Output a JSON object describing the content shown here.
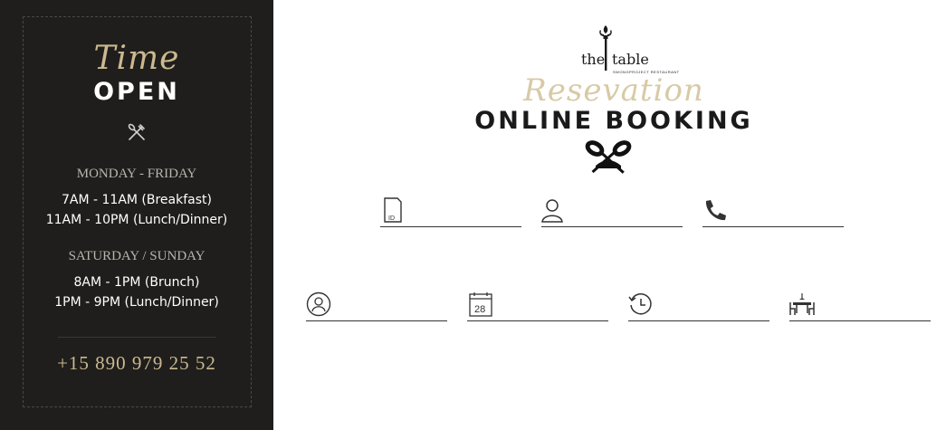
{
  "hours": {
    "script_title": "Time",
    "title": "OPEN",
    "weekday_heading": "MONDAY - FRIDAY",
    "weekday_lines": [
      "7AM - 11AM (Breakfast)",
      "11AM - 10PM (Lunch/Dinner)"
    ],
    "weekend_heading": "SATURDAY / SUNDAY",
    "weekend_lines": [
      "8AM - 1PM (Brunch)",
      "1PM - 9PM (Lunch/Dinner)"
    ],
    "phone": "+15 890 979 25 52"
  },
  "logo": {
    "word_the": "the",
    "word_table": "table",
    "tagline": "SWONGPROJECT RESTAURANT"
  },
  "booking": {
    "script_title": "Resevation",
    "title": "ONLINE BOOKING"
  },
  "form": {
    "date_day": "28",
    "fields": [
      {
        "icon": "id-card-icon",
        "value": ""
      },
      {
        "icon": "person-icon",
        "value": ""
      },
      {
        "icon": "phone-icon",
        "value": ""
      },
      {
        "icon": "guests-icon",
        "value": ""
      },
      {
        "icon": "calendar-icon",
        "value": ""
      },
      {
        "icon": "clock-icon",
        "value": ""
      },
      {
        "icon": "table-icon",
        "value": ""
      }
    ]
  },
  "colors": {
    "panel_bg": "#1f1e1c",
    "gold": "#cbb98f",
    "script_gold": "#d8caa6",
    "text_dark": "#1a1a1a"
  }
}
